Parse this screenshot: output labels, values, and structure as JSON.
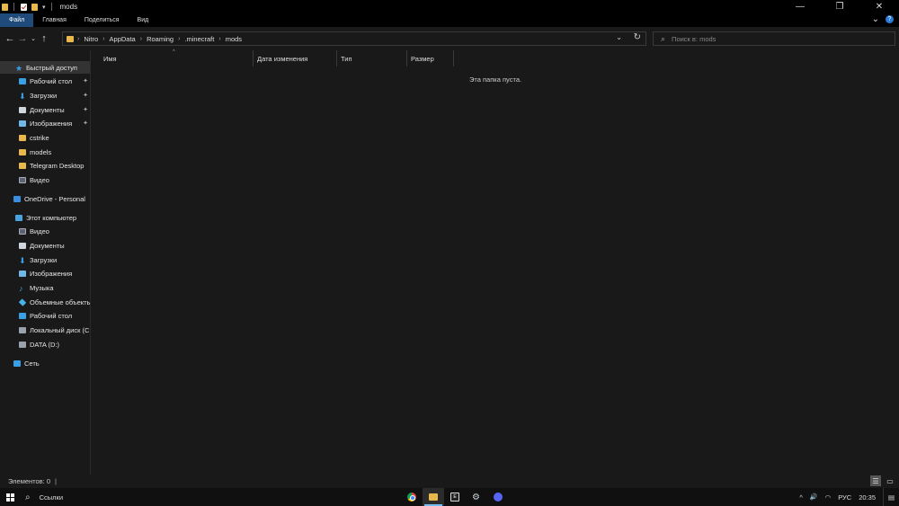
{
  "window": {
    "title": "mods",
    "controls": {
      "minimize": "—",
      "maximize": "❐",
      "close": "✕"
    }
  },
  "quick_access_toolbar": {
    "dropdown": "▾"
  },
  "ribbon": {
    "tabs": [
      {
        "label": "Файл",
        "active": true
      },
      {
        "label": "Главная"
      },
      {
        "label": "Поделиться"
      },
      {
        "label": "Вид"
      }
    ],
    "expand_icon": "⌄",
    "help_icon": "?"
  },
  "navigation": {
    "back": "←",
    "forward": "→",
    "recent": "⌄",
    "up": "↑"
  },
  "address": {
    "crumbs": [
      "Nitro",
      "AppData",
      "Roaming",
      ".minecraft",
      "mods"
    ],
    "separator": "›",
    "dropdown": "⌄",
    "refresh": "↻"
  },
  "search": {
    "placeholder": "Поиск в: mods",
    "icon": "search-icon"
  },
  "sidebar": {
    "items": [
      {
        "label": "Быстрый доступ",
        "icon": "star-icon",
        "color": "#3aa0e6",
        "selected": true,
        "indent": 1
      },
      {
        "label": "Рабочий стол",
        "icon": "desktop-icon",
        "pinned": true,
        "indent": 2
      },
      {
        "label": "Загрузки",
        "icon": "download-icon",
        "pinned": true,
        "indent": 2
      },
      {
        "label": "Документы",
        "icon": "documents-icon",
        "pinned": true,
        "indent": 2
      },
      {
        "label": "Изображения",
        "icon": "pictures-icon",
        "pinned": true,
        "indent": 2
      },
      {
        "label": "cstrike",
        "icon": "folder-icon",
        "indent": 2
      },
      {
        "label": "models",
        "icon": "folder-icon",
        "indent": 2
      },
      {
        "label": "Telegram Desktop",
        "icon": "folder-icon",
        "indent": 2
      },
      {
        "label": "Видео",
        "icon": "video-icon",
        "indent": 2
      },
      {
        "label": "OneDrive - Personal",
        "icon": "onedrive-icon",
        "indent": 1
      },
      {
        "label": "Этот компьютер",
        "icon": "computer-icon",
        "indent": 1
      },
      {
        "label": "Видео",
        "icon": "video-icon",
        "indent": 2
      },
      {
        "label": "Документы",
        "icon": "documents-icon",
        "indent": 2
      },
      {
        "label": "Загрузки",
        "icon": "download-icon",
        "indent": 2
      },
      {
        "label": "Изображения",
        "icon": "pictures-icon",
        "indent": 2
      },
      {
        "label": "Музыка",
        "icon": "music-icon",
        "indent": 2
      },
      {
        "label": "Объемные объекты",
        "icon": "3d-objects-icon",
        "indent": 2
      },
      {
        "label": "Рабочий стол",
        "icon": "desktop-icon",
        "indent": 2
      },
      {
        "label": "Локальный диск (C:)",
        "icon": "drive-icon",
        "indent": 2
      },
      {
        "label": "DATA (D:)",
        "icon": "drive-icon",
        "indent": 2
      },
      {
        "label": "Сеть",
        "icon": "network-icon",
        "indent": 1
      }
    ],
    "pin_glyph": "📌"
  },
  "columns": [
    {
      "label": "Имя"
    },
    {
      "label": "Дата изменения"
    },
    {
      "label": "Тип"
    },
    {
      "label": "Размер"
    }
  ],
  "sort_indicator": "^",
  "empty_message": "Эта папка пуста.",
  "statusbar": {
    "items_count": "Элементов: 0",
    "cursor": "|"
  },
  "taskbar": {
    "search_label": "Ссылки",
    "apps": [
      "chrome-icon",
      "file-explorer-icon",
      "epic-games-icon",
      "steam-icon",
      "discord-icon"
    ],
    "tray": {
      "chevron": "^",
      "volume": "🔊",
      "language": "РУС",
      "time": "20:35"
    },
    "notification_icon": "notification-icon"
  },
  "colors": {
    "accent": "#1f4b7a",
    "folder": "#e8b84a",
    "background": "#191919"
  }
}
